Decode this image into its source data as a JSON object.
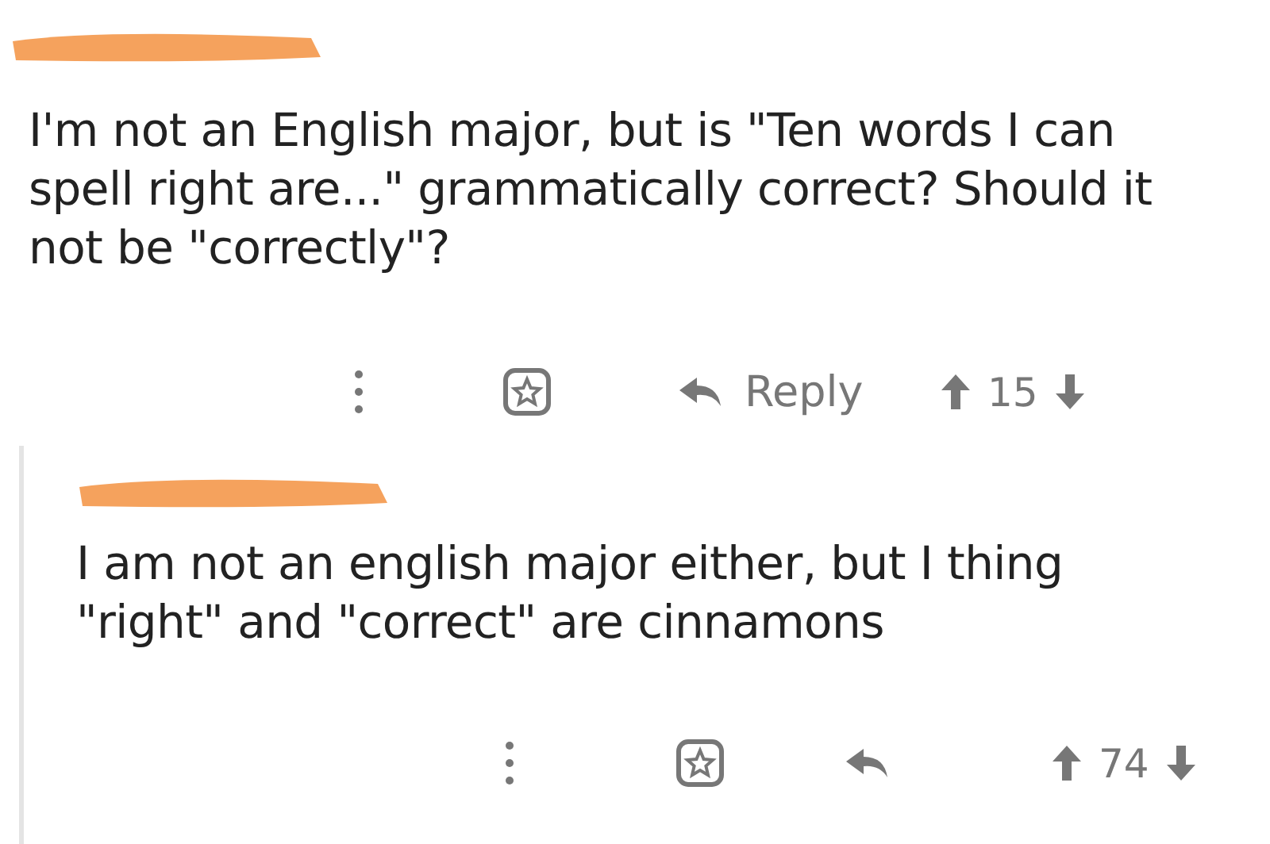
{
  "comments": [
    {
      "text": "I'm not an English major, but is \"Ten words I can spell right are...\" grammatically correct? Should it not be \"correctly\"?",
      "reply_label": "Reply",
      "score": "15"
    },
    {
      "text": "I am not an english major either, but I thing \"right\" and \"correct\" are cinnamons",
      "score": "74"
    }
  ]
}
